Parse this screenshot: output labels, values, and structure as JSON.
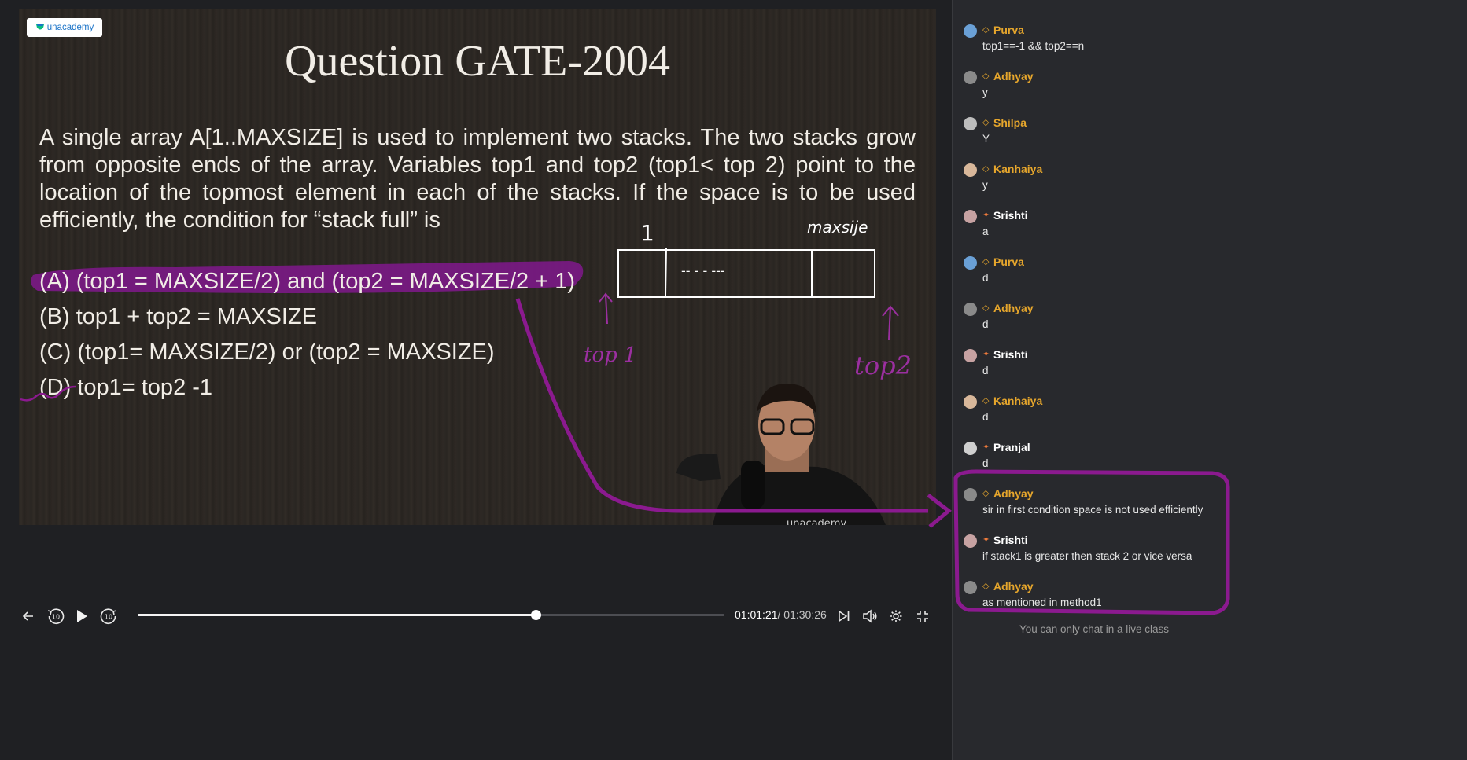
{
  "brand": {
    "logo_text": "unacademy"
  },
  "slide": {
    "title": "Question GATE-2004",
    "question": "A single array A[1..MAXSIZE] is used to implement two stacks. The two stacks grow from opposite ends of the array. Variables top1 and top2 (top1< top 2) point to the location of the topmost element in each of the stacks. If the space is to be used efficiently, the condition for “stack full” is",
    "options": [
      "(A) (top1 = MAXSIZE/2) and (top2 = MAXSIZE/2 + 1)",
      "(B) top1 + top2 = MAXSIZE",
      "(C) (top1= MAXSIZE/2) or (top2 = MAXSIZE)",
      "(D) top1= top2 -1"
    ],
    "handwriting": {
      "one": "1",
      "maxsize": "maxsije",
      "top1": "top 1",
      "top2": "top2",
      "dashes": "-- -  -   ---"
    },
    "annotation_color": "#8b1a8f",
    "watermark": "unacademy"
  },
  "controls": {
    "back_icon": "arrow-left-icon",
    "rewind_label": "10",
    "forward_label": "10",
    "current_time": "01:01:21",
    "total_time": "/ 01:30:26",
    "progress_fraction": 0.678
  },
  "chat": {
    "messages": [
      {
        "name": "Purva",
        "text": "top1==-1 && top2==n",
        "role": "plus",
        "color": "#e6a62c"
      },
      {
        "name": "Adhyay",
        "text": "y",
        "role": "plus",
        "color": "#e6a62c"
      },
      {
        "name": "Shilpa",
        "text": "Y",
        "role": "plus",
        "color": "#e6a62c"
      },
      {
        "name": "Kanhaiya",
        "text": "y",
        "role": "plus",
        "color": "#e6a62c"
      },
      {
        "name": "Srishti",
        "text": "a",
        "role": "iconic",
        "color": "#ffffff"
      },
      {
        "name": "Purva",
        "text": "d",
        "role": "plus",
        "color": "#e6a62c"
      },
      {
        "name": "Adhyay",
        "text": "d",
        "role": "plus",
        "color": "#e6a62c"
      },
      {
        "name": "Srishti",
        "text": "d",
        "role": "iconic",
        "color": "#ffffff"
      },
      {
        "name": "Kanhaiya",
        "text": "d",
        "role": "plus",
        "color": "#e6a62c"
      },
      {
        "name": "Pranjal",
        "text": "d",
        "role": "iconic",
        "color": "#ffffff"
      },
      {
        "name": "Adhyay",
        "text": "sir in first condition space is not used efficiently",
        "role": "plus",
        "color": "#e6a62c"
      },
      {
        "name": "Srishti",
        "text": "if stack1 is greater then stack 2 or vice versa",
        "role": "iconic",
        "color": "#ffffff"
      },
      {
        "name": "Adhyay",
        "text": "as mentioned in method1",
        "role": "plus",
        "color": "#e6a62c"
      }
    ],
    "footer": "You can only chat in a live class"
  }
}
